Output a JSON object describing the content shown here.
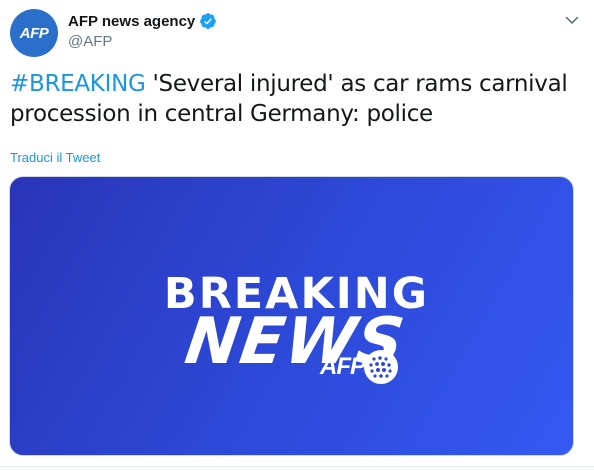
{
  "author": {
    "name": "AFP news agency",
    "handle": "@AFP",
    "avatar_label": "AFP",
    "verified": true
  },
  "tweet": {
    "hashtag": "#BREAKING",
    "text": " 'Several injured' as car rams carnival procession in central Germany: police",
    "translate_label": "Traduci il Tweet"
  },
  "media": {
    "line1": "BREAKING",
    "line2": "NEWS",
    "logo_label": "AFP"
  },
  "colors": {
    "link": "#1b95e0",
    "verified": "#1da1f2",
    "media_gradient_start": "#2a34b8",
    "media_gradient_end": "#3459f2"
  },
  "icons": {
    "verified": "verified-badge-icon",
    "menu": "chevron-down-icon",
    "logo_globe": "globe-icon"
  }
}
